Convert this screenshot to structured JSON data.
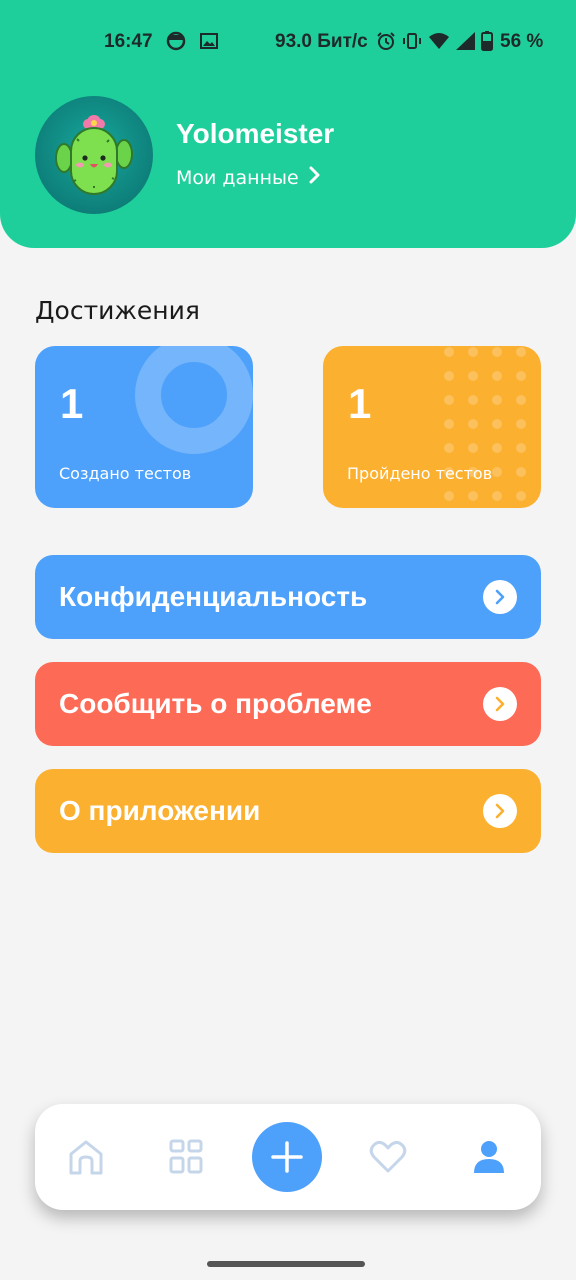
{
  "status_bar": {
    "time": "16:47",
    "speed": "93.0 Бит/с",
    "battery": "56 %"
  },
  "profile": {
    "username": "Yolomeister",
    "my_data_link": "Мои данные",
    "avatar_icon": "cactus-icon"
  },
  "achievements": {
    "title": "Достижения",
    "created": {
      "count": "1",
      "label": "Создано тестов",
      "color": "#4ea1fb"
    },
    "passed": {
      "count": "1",
      "label": "Пройдено тестов",
      "color": "#fbb030"
    }
  },
  "menu": [
    {
      "label": "Конфиденциальность",
      "color": "#4ea1fb"
    },
    {
      "label": "Сообщить о проблеме",
      "color": "#fd6a56"
    },
    {
      "label": "О приложении",
      "color": "#fbb030"
    }
  ],
  "bottom_nav": {
    "items": [
      "home-icon",
      "grid-icon",
      "plus-icon",
      "heart-icon",
      "user-icon"
    ],
    "active": "user-icon"
  },
  "colors": {
    "header": "#1fcf9b",
    "background": "#f4f4f4",
    "accent_blue": "#4ea1fb"
  }
}
